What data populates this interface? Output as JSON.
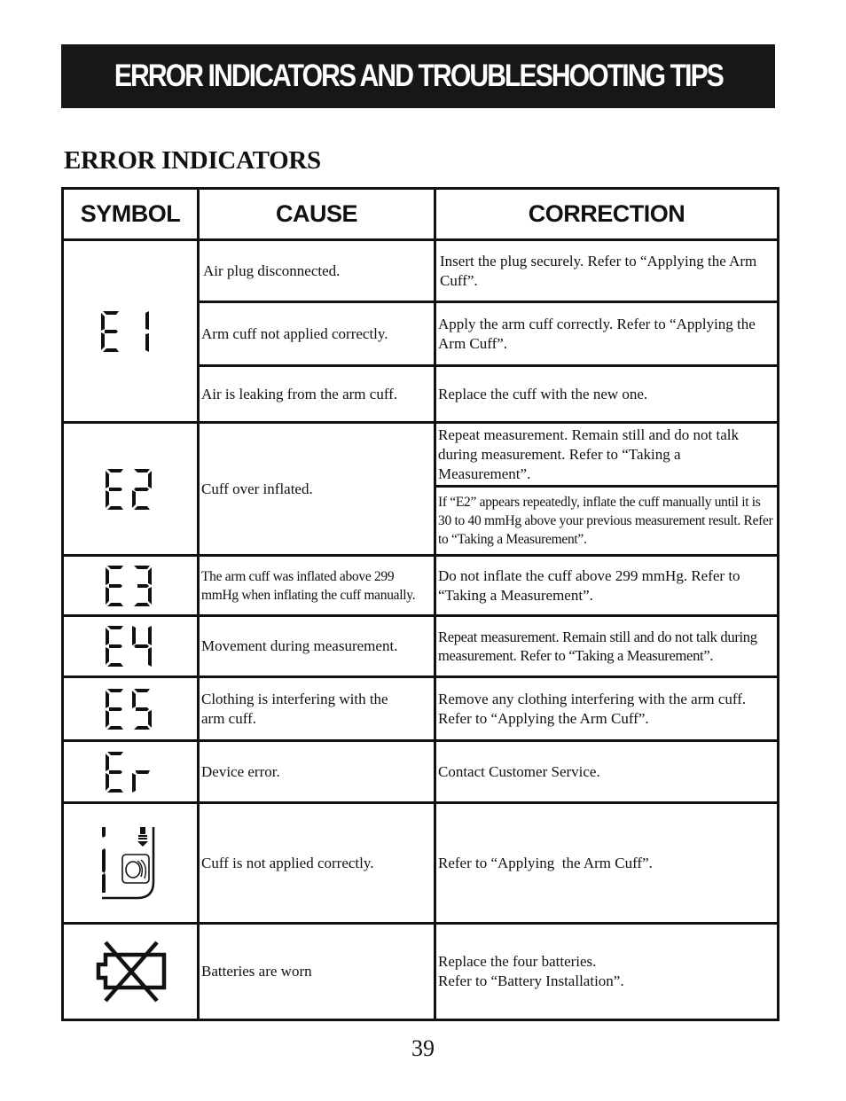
{
  "page": {
    "banner_title": "ERROR INDICATORS AND TROUBLESHOOTING TIPS",
    "section_title": "ERROR INDICATORS",
    "page_number": "39"
  },
  "table": {
    "headers": {
      "symbol": "SYMBOL",
      "cause": "CAUSE",
      "correction": "CORRECTION"
    },
    "rows": [
      {
        "symbol": "E1",
        "symbol_icon": "lcd-e1-icon",
        "entries": [
          {
            "cause": "Air plug disconnected.",
            "correction": "Insert the plug securely. Refer to “Applying the Arm Cuff”."
          },
          {
            "cause": "Arm cuff not applied correctly.",
            "correction": "Apply the arm cuff correctly. Refer to “Applying the Arm Cuff”."
          },
          {
            "cause": "Air is leaking from the arm cuff.",
            "correction": "Replace the cuff with the new one."
          }
        ]
      },
      {
        "symbol": "E2",
        "symbol_icon": "lcd-e2-icon",
        "cause": "Cuff over inflated.",
        "corrections": [
          "Repeat measurement. Remain still and do not talk during measurement. Refer to “Taking a Measurement”.",
          "If “E2” appears repeatedly, inflate the cuff manually until it is 30 to 40 mmHg above your previous measurement result. Refer to “Taking a Measurement”."
        ]
      },
      {
        "symbol": "E3",
        "symbol_icon": "lcd-e3-icon",
        "cause": "The arm cuff was inflated above 299 mmHg when inflating the cuff manually.",
        "correction": "Do not inflate the cuff above 299 mmHg. Refer to “Taking a Measurement”."
      },
      {
        "symbol": "E4",
        "symbol_icon": "lcd-e4-icon",
        "cause": "Movement during measurement.",
        "correction": "Repeat measurement. Remain still and do not talk during measurement. Refer to “Taking a Measurement”."
      },
      {
        "symbol": "E5",
        "symbol_icon": "lcd-e5-icon",
        "cause": "Clothing is interfering with the arm cuff.",
        "correction": "Remove any clothing interfering with the arm cuff. Refer to “Applying the Arm Cuff”."
      },
      {
        "symbol": "Er",
        "symbol_icon": "lcd-er-icon",
        "cause": "Device error.",
        "correction": "Contact Customer Service."
      },
      {
        "symbol": "cuff-indicator",
        "symbol_icon": "cuff-wrap-indicator-icon",
        "cause": "Cuff is not applied correctly.",
        "correction": "Refer to “Applying  the Arm Cuff”."
      },
      {
        "symbol": "low-battery",
        "symbol_icon": "battery-crossed-icon",
        "cause": "Batteries are worn",
        "correction_lines": [
          "Replace the four batteries.",
          "Refer to “Battery Installation”."
        ]
      }
    ]
  }
}
